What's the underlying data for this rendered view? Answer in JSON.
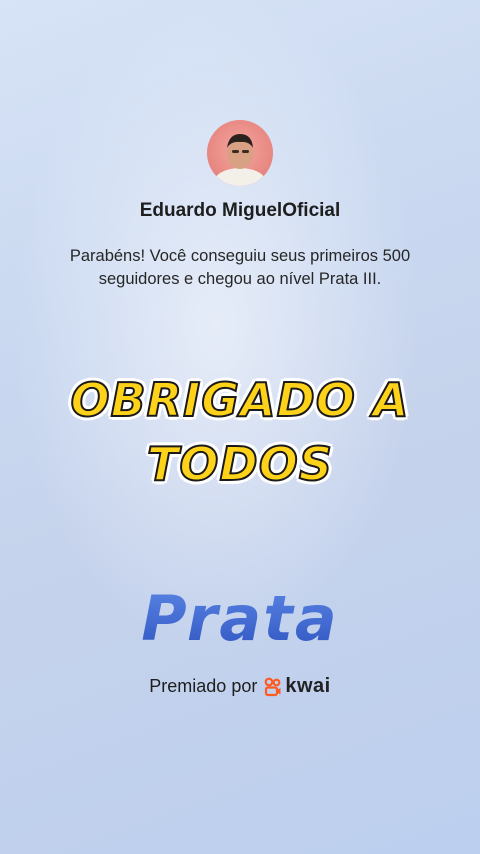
{
  "profile": {
    "name": "Eduardo MiguelOficial",
    "avatar_icon": "user-photo"
  },
  "message": "Parabéns! Você conseguiu seus primeiros 500 seguidores e chegou ao nível Prata III.",
  "caption": "OBRIGADO A TODOS",
  "level": "Prata",
  "awarded": {
    "label": "Premiado por",
    "brand": "kwai",
    "brand_icon": "kwai-logo-icon",
    "brand_color": "#ff5a1f"
  },
  "colors": {
    "caption_fill": "#ffd21a",
    "level_color": "#3f67cf"
  }
}
